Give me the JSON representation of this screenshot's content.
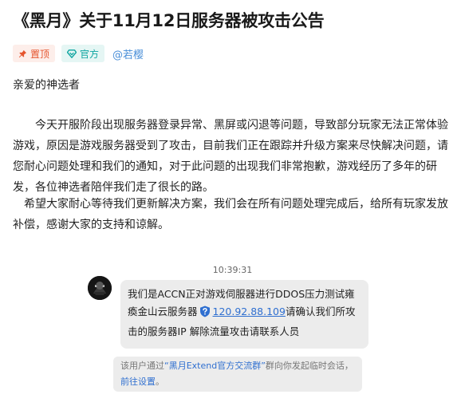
{
  "post": {
    "title": "《黑月》关于11月12日服务器被攻击公告",
    "tags": {
      "pinned": "置顶",
      "official": "官方"
    },
    "author": "@若樱",
    "greeting": "亲爱的神选者",
    "paragraph1": "　　今天开服阶段出现服务器登录异常、黑屏或闪退等问题，导致部分玩家无法正常体验游戏，原因是游戏服务器受到了攻击，目前我们正在跟踪并升级方案来尽快解决问题，请您耐心问题处理和我们的通知，对于此问题的出现我们非常抱歉，游戏经历了多年的研发，各位神选者陪伴我们走了很长的路。",
    "paragraph2": "　希望大家耐心等待我们更新解决方案，我们会在所有问题处理完成后，给所有玩家发放补偿，感谢大家的支持和谅解。"
  },
  "chat": {
    "timestamp": "10:39:31",
    "message": {
      "text_before_ip": "我们是ACCN正对游戏伺服器进行DDOS压力测试雍瘓金山云服务器",
      "ip": "120.92.88.109",
      "text_after_ip": "请确认我们所攻击的服务器IP 解除流量攻击请联系人员"
    },
    "notice": {
      "prefix": "该用户通过",
      "group_link": "“黑月Extend官方交流群”",
      "middle": "群向你发起临时会话，",
      "settings_link": "前往设置",
      "suffix": "。"
    }
  },
  "colors": {
    "pinned_tag_bg": "#fdeeea",
    "pinned_tag_text": "#e5552f",
    "official_tag_bg": "#e5f6f4",
    "official_tag_text": "#0ea5a0",
    "author_link": "#4a8fd8",
    "bubble_bg": "#ececec",
    "link_blue": "#2f6fd0"
  },
  "icons": {
    "pinned": "pin-icon",
    "official": "diamond-icon",
    "verified": "shield-question-icon",
    "avatar": "user-avatar"
  }
}
